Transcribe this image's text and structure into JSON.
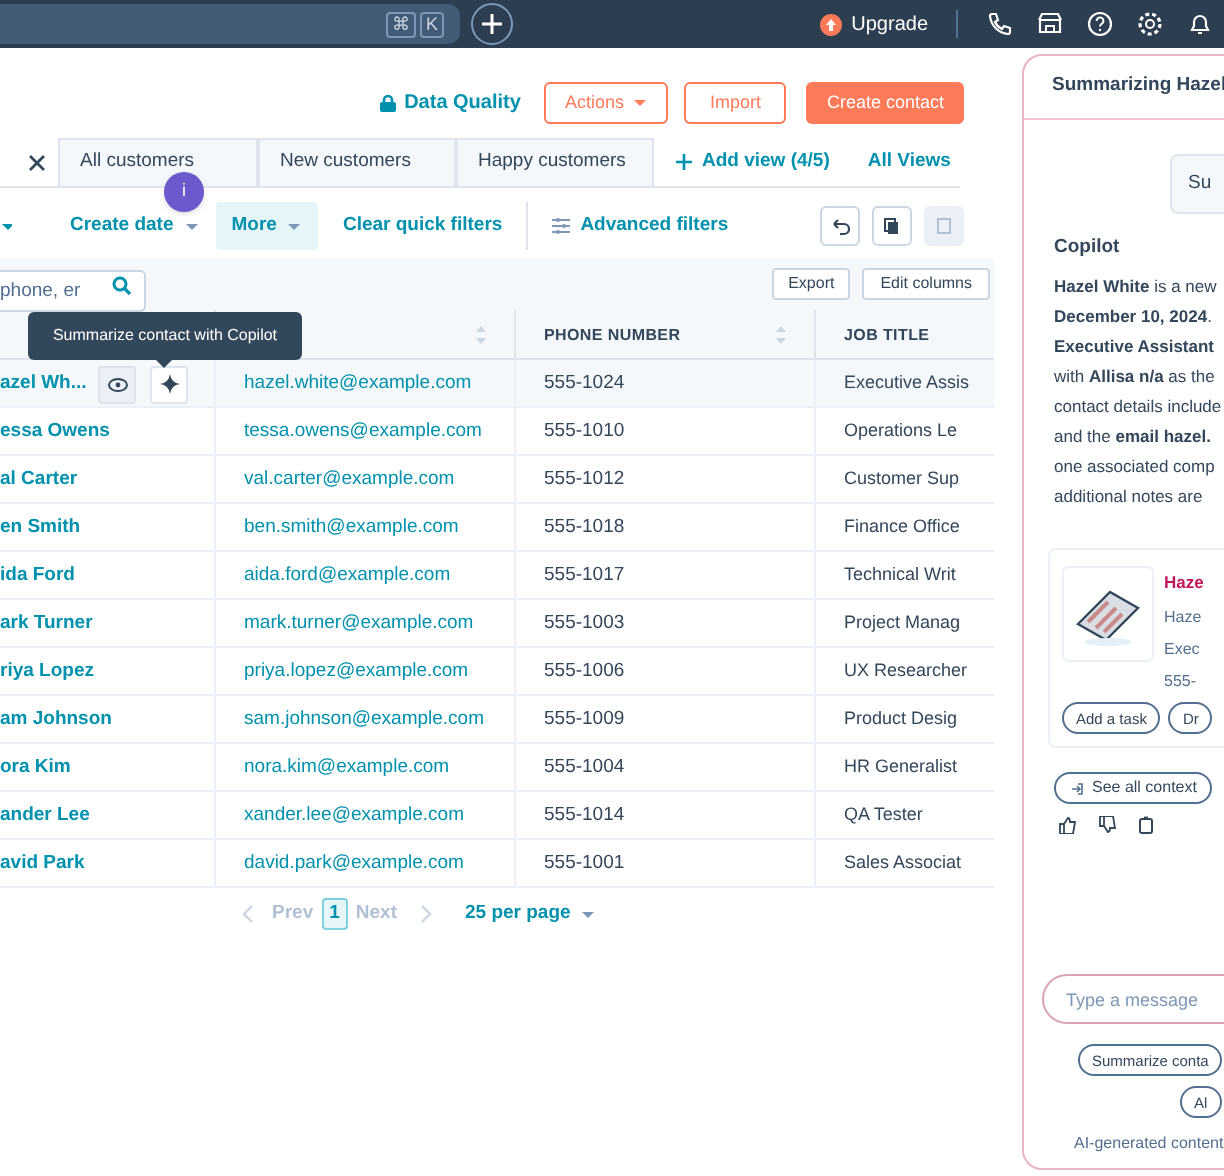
{
  "topbar": {
    "shortcut_keys": [
      "⌘",
      "K"
    ],
    "upgrade": "Upgrade"
  },
  "header_actions": {
    "data_quality": "Data Quality",
    "actions": "Actions",
    "import": "Import",
    "create": "Create contact"
  },
  "view_tabs": [
    "All customers",
    "New customers",
    "Happy customers"
  ],
  "add_view": "Add view (4/5)",
  "all_views": "All Views",
  "filters": [
    {
      "label": "Create date",
      "kind": "dropdown",
      "highlighted": false
    },
    {
      "label": "More",
      "kind": "dropdown",
      "highlighted": true
    },
    {
      "label": "Clear quick filters",
      "kind": "link",
      "highlighted": false
    },
    {
      "label": "Advanced filters",
      "kind": "advanced",
      "highlighted": false
    }
  ],
  "info_badge": "i",
  "search": {
    "placeholder": "phone, er"
  },
  "export": "Export",
  "edit_columns": "Edit columns",
  "tooltip": "Summarize contact with Copilot",
  "table": {
    "columns": [
      "PHONE NUMBER",
      "JOB TITLE"
    ],
    "rows": [
      {
        "name": "azel Wh...",
        "email": "hazel.white@example.com",
        "phone": "555-1024",
        "job_title": "Executive Assis",
        "hovered": true
      },
      {
        "name": "essa Owens",
        "email": "tessa.owens@example.com",
        "phone": "555-1010",
        "job_title": "Operations Le",
        "hovered": false
      },
      {
        "name": "al Carter",
        "email": "val.carter@example.com",
        "phone": "555-1012",
        "job_title": "Customer Sup",
        "hovered": false
      },
      {
        "name": "en Smith",
        "email": "ben.smith@example.com",
        "phone": "555-1018",
        "job_title": "Finance Office",
        "hovered": false
      },
      {
        "name": "ida Ford",
        "email": "aida.ford@example.com",
        "phone": "555-1017",
        "job_title": "Technical Writ",
        "hovered": false
      },
      {
        "name": "ark Turner",
        "email": "mark.turner@example.com",
        "phone": "555-1003",
        "job_title": "Project Manag",
        "hovered": false
      },
      {
        "name": "riya Lopez",
        "email": "priya.lopez@example.com",
        "phone": "555-1006",
        "job_title": "UX Researcher",
        "hovered": false
      },
      {
        "name": "am Johnson",
        "email": "sam.johnson@example.com",
        "phone": "555-1009",
        "job_title": "Product Desig",
        "hovered": false
      },
      {
        "name": "ora Kim",
        "email": "nora.kim@example.com",
        "phone": "555-1004",
        "job_title": "HR Generalist",
        "hovered": false
      },
      {
        "name": "ander Lee",
        "email": "xander.lee@example.com",
        "phone": "555-1014",
        "job_title": "QA Tester",
        "hovered": false
      },
      {
        "name": "avid Park",
        "email": "david.park@example.com",
        "phone": "555-1001",
        "job_title": "Sales Associat",
        "hovered": false
      }
    ]
  },
  "pagination": {
    "prev": "Prev",
    "page": "1",
    "next": "Next",
    "per_page": "25 per page"
  },
  "panel": {
    "title": "Summarizing Hazel",
    "summarize_button": "Su",
    "heading": "Copilot",
    "summary_lines": [
      "**Hazel White** is a new",
      "**December 10, 2024**.",
      "**Executive Assistant**",
      "with **Allisa n/a** as the",
      "contact details include",
      "and the **email hazel.**",
      "one associated comp",
      "additional notes are"
    ],
    "card": {
      "name": "Haze",
      "lines": [
        "Haze",
        "Exec",
        "555-"
      ],
      "buttons": [
        "Add a task",
        "Dr"
      ]
    },
    "see_all": "See all context",
    "message": {
      "placeholder": "Type a message"
    },
    "chips": [
      "Summarize conta",
      "Al"
    ],
    "footer": "AI-generated content"
  }
}
